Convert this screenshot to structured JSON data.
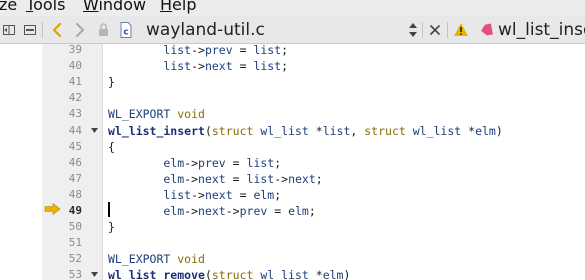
{
  "menubar": {
    "items": [
      {
        "pre": "",
        "mn": "",
        "post": "ze"
      },
      {
        "pre": "",
        "mn": "T",
        "post": "ools"
      },
      {
        "pre": "",
        "mn": "W",
        "post": "indow"
      },
      {
        "pre": "",
        "mn": "H",
        "post": "elp"
      }
    ]
  },
  "toolbar": {
    "file_title": "wayland-util.c",
    "tab_title": "wl_list_inse",
    "icons": [
      "split-view-icon",
      "panel-icon",
      "back-arrow-icon",
      "forward-arrow-icon",
      "lock-icon",
      "c-file-icon",
      "updown-chooser-icon",
      "close-icon",
      "warning-icon",
      "bookmark-icon"
    ],
    "colors": {
      "back_arrow": "#e0a000",
      "warning": "#e8b400",
      "bookmark": "#e05080"
    }
  },
  "editor": {
    "current_line": "49",
    "lines": [
      {
        "num": "39",
        "fold": false,
        "tokens": [
          {
            "t": "        "
          },
          {
            "t": "list",
            "c": "tok-id"
          },
          {
            "t": "->"
          },
          {
            "t": "prev",
            "c": "tok-id"
          },
          {
            "t": " = "
          },
          {
            "t": "list",
            "c": "tok-id"
          },
          {
            "t": ";"
          }
        ]
      },
      {
        "num": "40",
        "fold": false,
        "tokens": [
          {
            "t": "        "
          },
          {
            "t": "list",
            "c": "tok-id"
          },
          {
            "t": "->"
          },
          {
            "t": "next",
            "c": "tok-id"
          },
          {
            "t": " = "
          },
          {
            "t": "list",
            "c": "tok-id"
          },
          {
            "t": ";"
          }
        ]
      },
      {
        "num": "41",
        "fold": false,
        "tokens": [
          {
            "t": "}"
          }
        ]
      },
      {
        "num": "42",
        "fold": false,
        "tokens": []
      },
      {
        "num": "43",
        "fold": false,
        "tokens": [
          {
            "t": "WL_EXPORT",
            "c": "tok-macro"
          },
          {
            "t": " "
          },
          {
            "t": "void",
            "c": "tok-kw"
          }
        ]
      },
      {
        "num": "44",
        "fold": true,
        "tokens": [
          {
            "t": "wl_list_insert",
            "c": "tok-fn"
          },
          {
            "t": "("
          },
          {
            "t": "struct",
            "c": "tok-kw"
          },
          {
            "t": " "
          },
          {
            "t": "wl_list",
            "c": "tok-id"
          },
          {
            "t": " *"
          },
          {
            "t": "list",
            "c": "tok-id"
          },
          {
            "t": ", "
          },
          {
            "t": "struct",
            "c": "tok-kw"
          },
          {
            "t": " "
          },
          {
            "t": "wl_list",
            "c": "tok-id"
          },
          {
            "t": " *"
          },
          {
            "t": "elm",
            "c": "tok-id"
          },
          {
            "t": ")"
          }
        ]
      },
      {
        "num": "45",
        "fold": false,
        "tokens": [
          {
            "t": "{"
          }
        ]
      },
      {
        "num": "46",
        "fold": false,
        "tokens": [
          {
            "t": "        "
          },
          {
            "t": "elm",
            "c": "tok-id"
          },
          {
            "t": "->"
          },
          {
            "t": "prev",
            "c": "tok-id"
          },
          {
            "t": " = "
          },
          {
            "t": "list",
            "c": "tok-id"
          },
          {
            "t": ";"
          }
        ]
      },
      {
        "num": "47",
        "fold": false,
        "tokens": [
          {
            "t": "        "
          },
          {
            "t": "elm",
            "c": "tok-id"
          },
          {
            "t": "->"
          },
          {
            "t": "next",
            "c": "tok-id"
          },
          {
            "t": " = "
          },
          {
            "t": "list",
            "c": "tok-id"
          },
          {
            "t": "->"
          },
          {
            "t": "next",
            "c": "tok-id"
          },
          {
            "t": ";"
          }
        ]
      },
      {
        "num": "48",
        "fold": false,
        "tokens": [
          {
            "t": "        "
          },
          {
            "t": "list",
            "c": "tok-id"
          },
          {
            "t": "->"
          },
          {
            "t": "next",
            "c": "tok-id"
          },
          {
            "t": " = "
          },
          {
            "t": "elm",
            "c": "tok-id"
          },
          {
            "t": ";"
          }
        ]
      },
      {
        "num": "49",
        "fold": false,
        "tokens": [
          {
            "t": "        "
          },
          {
            "t": "elm",
            "c": "tok-id"
          },
          {
            "t": "->"
          },
          {
            "t": "next",
            "c": "tok-id"
          },
          {
            "t": "->"
          },
          {
            "t": "prev",
            "c": "tok-id"
          },
          {
            "t": " = "
          },
          {
            "t": "elm",
            "c": "tok-id"
          },
          {
            "t": ";"
          }
        ]
      },
      {
        "num": "50",
        "fold": false,
        "tokens": [
          {
            "t": "}"
          }
        ]
      },
      {
        "num": "51",
        "fold": false,
        "tokens": []
      },
      {
        "num": "52",
        "fold": false,
        "tokens": [
          {
            "t": "WL_EXPORT",
            "c": "tok-macro"
          },
          {
            "t": " "
          },
          {
            "t": "void",
            "c": "tok-kw"
          }
        ]
      },
      {
        "num": "53",
        "fold": true,
        "tokens": [
          {
            "t": "wl_list_remove",
            "c": "tok-fn"
          },
          {
            "t": "("
          },
          {
            "t": "struct",
            "c": "tok-kw"
          },
          {
            "t": " "
          },
          {
            "t": "wl_list",
            "c": "tok-id"
          },
          {
            "t": " *"
          },
          {
            "t": "elm",
            "c": "tok-id"
          },
          {
            "t": ")"
          }
        ]
      }
    ]
  }
}
